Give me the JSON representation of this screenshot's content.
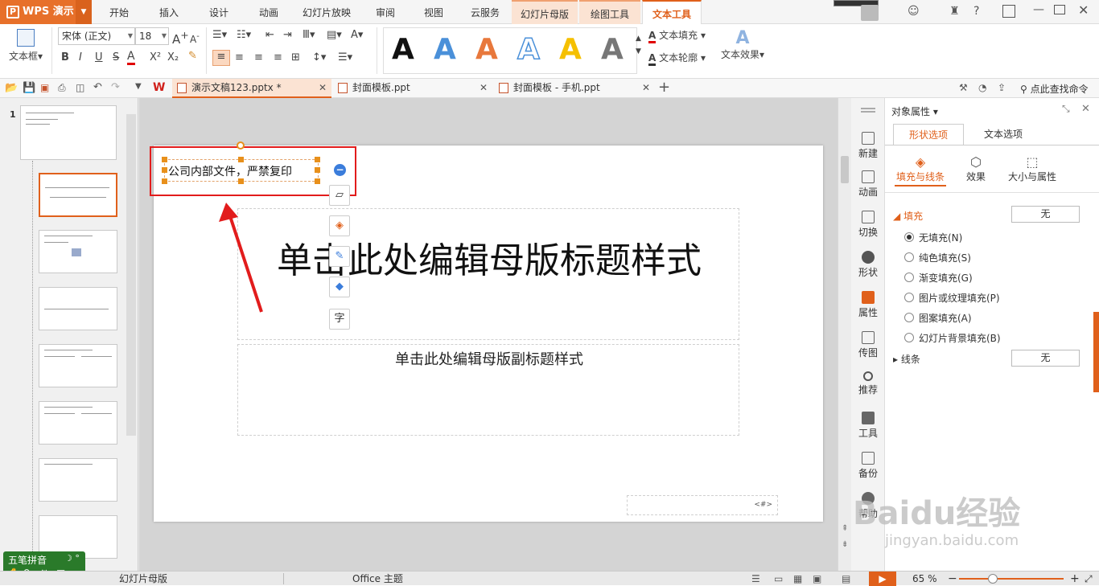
{
  "app": {
    "logo": "WPS 演示",
    "logo_p": "P"
  },
  "menu": {
    "tabs": [
      "开始",
      "插入",
      "设计",
      "动画",
      "幻灯片放映",
      "审阅",
      "视图",
      "云服务"
    ],
    "context_tabs": [
      "幻灯片母版",
      "绘图工具"
    ],
    "active_tab": "文本工具"
  },
  "ribbon": {
    "textbox_label": "文本框",
    "font_name": "宋体 (正文)",
    "font_size": "18",
    "text_fill": "文本填充",
    "text_outline": "文本轮廓",
    "text_effect": "文本效果",
    "style_colors": [
      "#111111",
      "#4a90d9",
      "#e8783c",
      "#4a90d9",
      "#f5c000",
      "#777777"
    ],
    "style_glyph": "A",
    "bold": "B",
    "italic": "I",
    "underline": "U",
    "strike": "S",
    "font_color": "A",
    "grow": "A",
    "shrink": "A"
  },
  "tabs": {
    "docs": [
      {
        "name": "演示文稿123.pptx *",
        "active": true
      },
      {
        "name": "封面模板.ppt",
        "active": false
      },
      {
        "name": "封面模板 - 手机.ppt",
        "active": false
      }
    ],
    "find": "点此查找命令",
    "add": "+"
  },
  "thumbs": {
    "slide_number": "1"
  },
  "slide": {
    "textbox_text": "公司内部文件，严禁复印",
    "title": "单击此处编辑母版标题样式",
    "subtitle": "单击此处编辑母版副标题样式",
    "footer_hash": "<#>"
  },
  "sidestrip": [
    "新建",
    "动画",
    "切换",
    "形状",
    "属性",
    "传图",
    "推荐",
    "工具",
    "备份",
    "帮助"
  ],
  "panel": {
    "title": "对象属性",
    "tabs": [
      "形状选项",
      "文本选项"
    ],
    "subtabs": [
      "填充与线条",
      "效果",
      "大小与属性"
    ],
    "fill_header": "填充",
    "fill_value": "无",
    "options": [
      "无填充(N)",
      "纯色填充(S)",
      "渐变填充(G)",
      "图片或纹理填充(P)",
      "图案填充(A)",
      "幻灯片背景填充(B)"
    ],
    "line_header": "线条",
    "line_value": "无"
  },
  "ime": {
    "name": "五笔拼音",
    "mode": "简"
  },
  "status": {
    "left": "幻灯片母版",
    "theme": "Office 主题",
    "zoom": "65 %"
  },
  "watermark": {
    "brand": "Baidu经验",
    "url": "jingyan.baidu.com"
  },
  "accent": "#e0601b"
}
